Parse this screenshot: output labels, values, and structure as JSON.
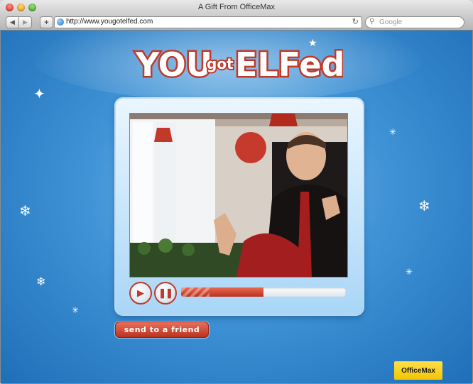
{
  "window": {
    "title": "A Gift From OfficeMax"
  },
  "toolbar": {
    "url": "http://www.yougotelfed.com",
    "search_placeholder": "Google",
    "add_label": "+",
    "reload_label": "↻",
    "back_label": "◀",
    "forward_label": "▶"
  },
  "page": {
    "logo_text": {
      "word1": "YOU",
      "word2": "got",
      "word3": "ELFed"
    },
    "player": {
      "play_label": "▶",
      "pause_label": "❚❚",
      "progress": 0.5
    },
    "send_button_label": "send to a friend",
    "brand_label": "OfficeMax"
  },
  "colors": {
    "background": "#3f93d6",
    "accent_red": "#c0392b",
    "brand_yellow": "#f3c400"
  }
}
